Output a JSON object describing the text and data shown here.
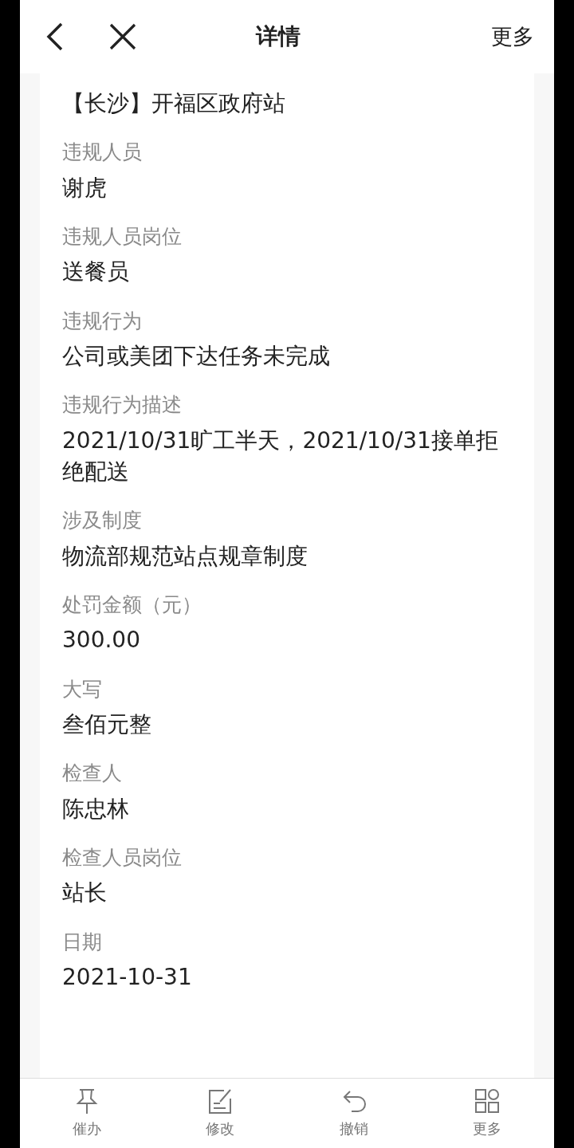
{
  "header": {
    "title": "详情",
    "more": "更多"
  },
  "top_value": "【长沙】开福区政府站",
  "fields": [
    {
      "label": "违规人员",
      "value": "谢虎"
    },
    {
      "label": "违规人员岗位",
      "value": "送餐员"
    },
    {
      "label": "违规行为",
      "value": "公司或美团下达任务未完成"
    },
    {
      "label": "违规行为描述",
      "value": "2021/10/31旷工半天，2021/10/31接单拒绝配送"
    },
    {
      "label": "涉及制度",
      "value": "物流部规范站点规章制度"
    },
    {
      "label": "处罚金额（元）",
      "value": "300.00"
    },
    {
      "label": "大写",
      "value": "叁佰元整"
    },
    {
      "label": "检查人",
      "value": "陈忠林"
    },
    {
      "label": "检查人员岗位",
      "value": "站长"
    },
    {
      "label": "日期",
      "value": "2021-10-31"
    }
  ],
  "toolbar": [
    {
      "kind": "pin",
      "label": "催办"
    },
    {
      "kind": "edit",
      "label": "修改"
    },
    {
      "kind": "undo",
      "label": "撤销"
    },
    {
      "kind": "grid",
      "label": "更多"
    }
  ]
}
